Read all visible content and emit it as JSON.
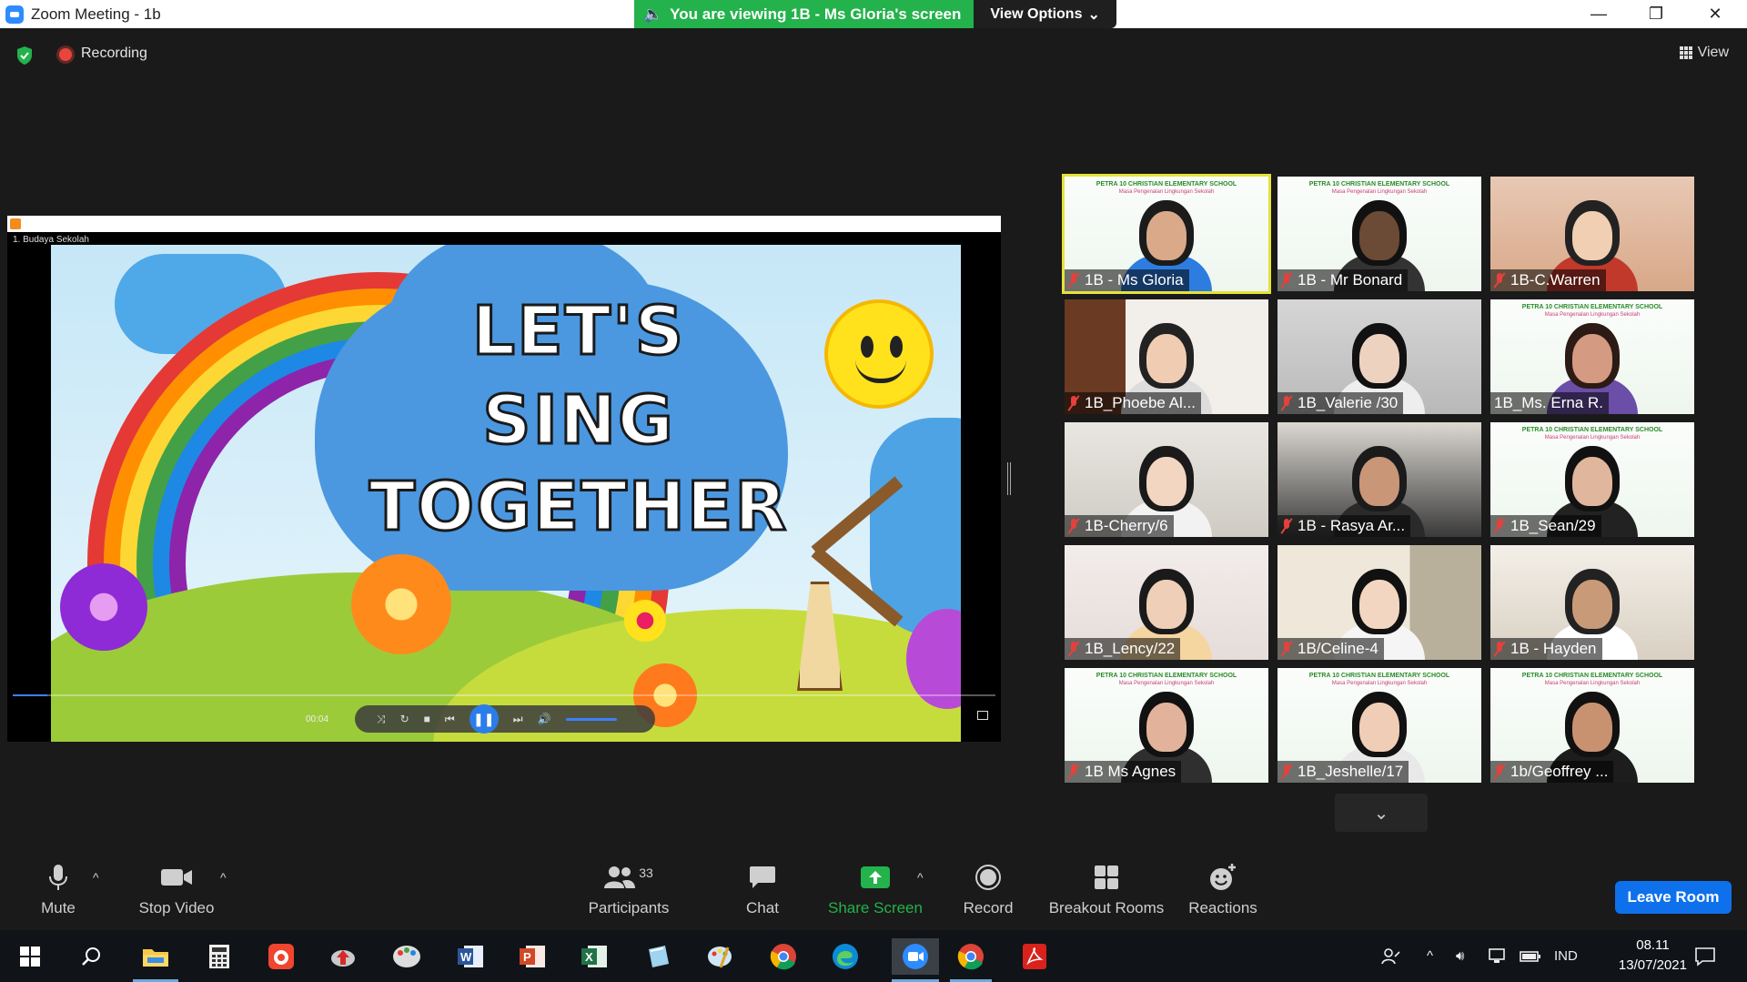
{
  "window": {
    "title": "Zoom Meeting - 1b",
    "banner_text": "You are viewing 1B - Ms Gloria's screen",
    "view_options_label": "View Options",
    "min_glyph": "—",
    "max_glyph": "❐",
    "close_glyph": "✕"
  },
  "meeting_bar": {
    "recording_label": "Recording",
    "view_label": "View"
  },
  "shared_screen": {
    "video_title": "1. Budaya Sekolah",
    "song_line1": "LET'S",
    "song_line2": "SING",
    "song_line3": "TOGETHER",
    "elapsed_time": "00:04",
    "progress_fraction": 0.035
  },
  "gallery": {
    "school_banner": "PETRA 10 CHRISTIAN ELEMENTARY SCHOOL",
    "school_sub": "Masa Pengenalan Lingkungan Sekolah",
    "participants": [
      {
        "name": "1B - Ms Gloria",
        "muted": true,
        "active": true
      },
      {
        "name": "1B - Mr Bonard",
        "muted": true
      },
      {
        "name": "1B-C.Warren",
        "muted": true
      },
      {
        "name": "1B_Phoebe Al...",
        "muted": true
      },
      {
        "name": "1B_Valerie /30",
        "muted": true
      },
      {
        "name": "1B_Ms. Erna R.",
        "muted": false
      },
      {
        "name": "1B-Cherry/6",
        "muted": true
      },
      {
        "name": "1B - Rasya Ar...",
        "muted": true
      },
      {
        "name": "1B_Sean/29",
        "muted": true
      },
      {
        "name": "1B_Lency/22",
        "muted": true
      },
      {
        "name": "1B/Celine-4",
        "muted": true
      },
      {
        "name": "1B - Hayden",
        "muted": true
      },
      {
        "name": "1B Ms Agnes",
        "muted": true
      },
      {
        "name": "1B_Jeshelle/17",
        "muted": true
      },
      {
        "name": "1b/Geoffrey ...",
        "muted": true
      }
    ],
    "scroll_down_glyph": "⌄"
  },
  "toolbar": {
    "mute_label": "Mute",
    "stop_video_label": "Stop Video",
    "participants_label": "Participants",
    "participants_count": "33",
    "chat_label": "Chat",
    "share_screen_label": "Share Screen",
    "record_label": "Record",
    "breakout_label": "Breakout Rooms",
    "reactions_label": "Reactions",
    "leave_label": "Leave Room"
  },
  "taskbar": {
    "language": "IND",
    "time": "08.11",
    "date": "13/07/2021"
  },
  "colors": {
    "accent_green": "#23b24b",
    "leave_blue": "#0e71eb",
    "mute_red": "#e5413b",
    "active_speaker_border": "#e6e23a"
  }
}
